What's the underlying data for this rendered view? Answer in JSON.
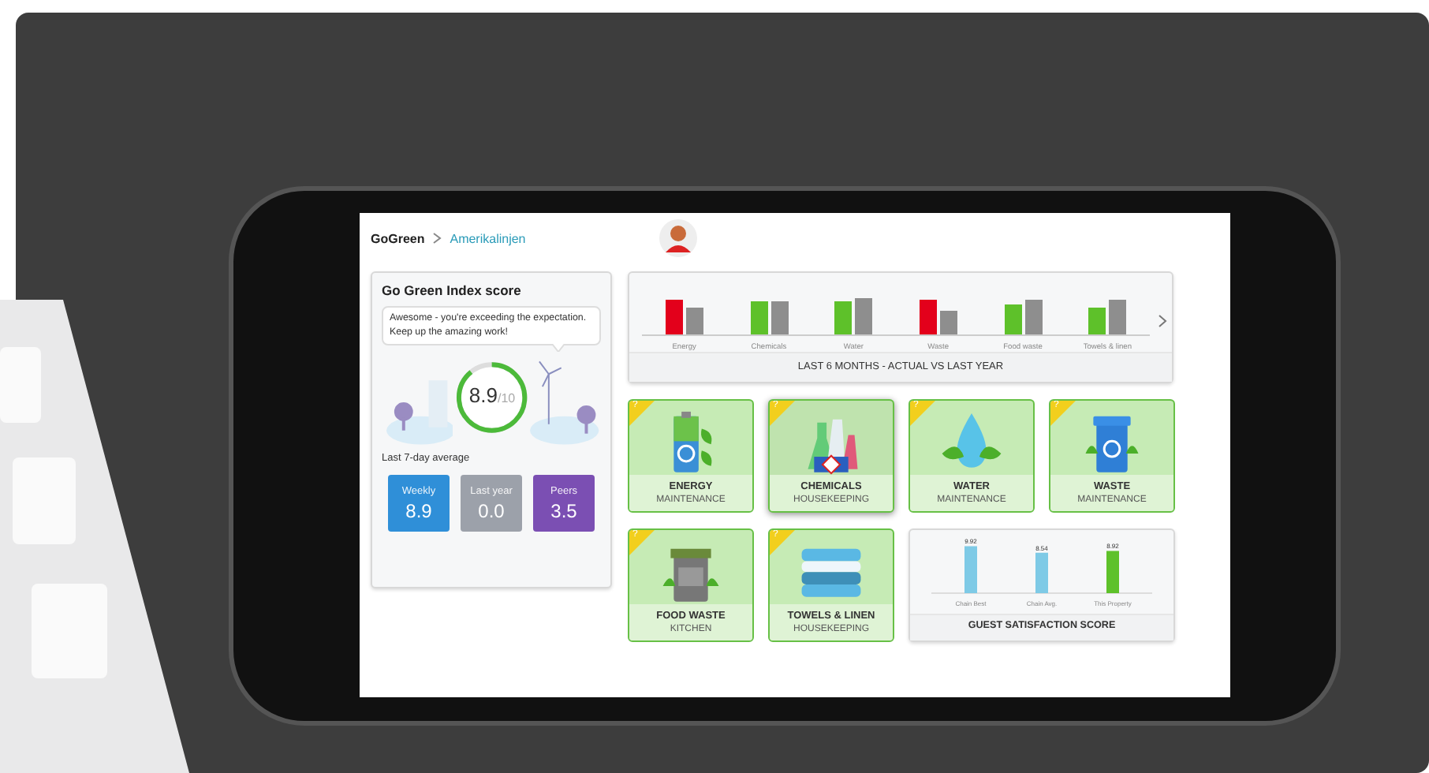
{
  "header": {
    "brand": "GoGreen",
    "breadcrumb": "Amerikalinjen"
  },
  "score_card": {
    "title": "Go Green Index score",
    "message": "Awesome - you're exceeding the expectation. Keep up the amazing work!",
    "gauge": {
      "value": "8.9",
      "max": "/10",
      "level": 0.89
    },
    "caption": "Last 7-day average",
    "stats": [
      {
        "label": "Weekly",
        "value": "8.9",
        "color": "#2f8fd8"
      },
      {
        "label": "Last year",
        "value": "0.0",
        "color": "#9ca1aa"
      },
      {
        "label": "Peers",
        "value": "3.5",
        "color": "#7b4fb3"
      }
    ]
  },
  "trend_card": {
    "title": "LAST 6 MONTHS - ACTUAL VS LAST YEAR",
    "categories": [
      {
        "label": "Energy",
        "color": "#e3001b"
      },
      {
        "label": "Chemicals",
        "color": "#5ec12a"
      },
      {
        "label": "Water",
        "color": "#5ec12a"
      },
      {
        "label": "Waste",
        "color": "#e3001b"
      },
      {
        "label": "Food waste",
        "color": "#5ec12a"
      },
      {
        "label": "Towels & linen",
        "color": "#5ec12a"
      }
    ]
  },
  "tiles": [
    {
      "kind": "battery",
      "badge": "?",
      "title": "ENERGY",
      "department": "MAINTENANCE",
      "selected": false
    },
    {
      "kind": "flasks",
      "badge": "?",
      "title": "CHEMICALS",
      "department": "HOUSEKEEPING",
      "selected": true
    },
    {
      "kind": "droplet",
      "badge": "?",
      "title": "WATER",
      "department": "MAINTENANCE",
      "selected": false
    },
    {
      "kind": "bin",
      "badge": "?",
      "title": "WASTE",
      "department": "MAINTENANCE",
      "selected": false
    },
    {
      "kind": "foodbin",
      "badge": "?",
      "title": "FOOD WASTE",
      "department": "KITCHEN",
      "selected": false
    },
    {
      "kind": "towels",
      "badge": "?",
      "title": "TOWELS & LINEN",
      "department": "HOUSEKEEPING",
      "selected": false
    }
  ],
  "guest_card": {
    "title": "GUEST SATISFACTION SCORE",
    "chart_data": {
      "type": "bar",
      "categories": [
        "Chain Best",
        "Chain Avg.",
        "This Property"
      ],
      "stacked": true,
      "data_labels": true,
      "series": [
        {
          "color": "#7ecae6",
          "values": [
            9.92,
            8.54,
            null
          ]
        },
        {
          "color": "#5ec12a",
          "values": [
            null,
            null,
            8.92
          ]
        }
      ]
    }
  }
}
